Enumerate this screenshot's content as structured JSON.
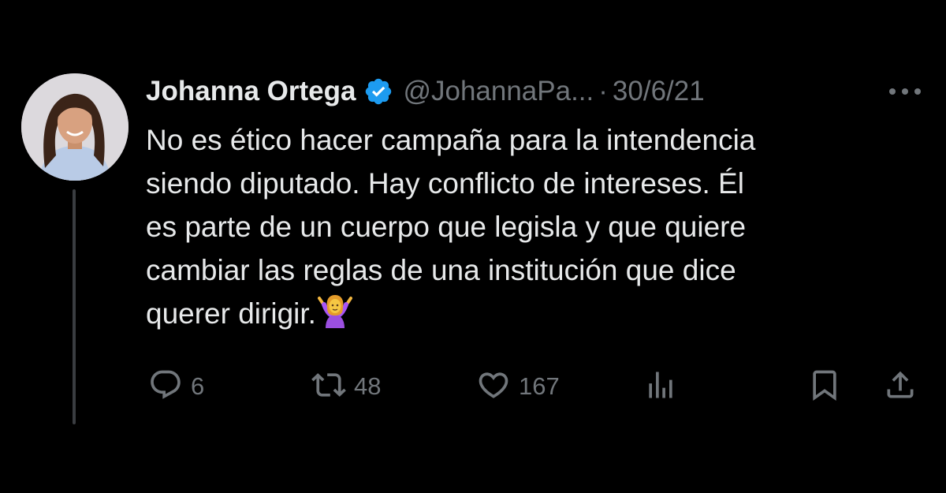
{
  "tweet": {
    "author": {
      "name": "Johanna Ortega",
      "handle": "@JohannaPa...",
      "verified": true
    },
    "separator": "·",
    "date": "30/6/21",
    "body_lines": [
      "No es ético hacer campaña para la intendencia",
      "siendo diputado. Hay conflicto de intereses. Él",
      "es parte de un cuerpo que legisla y que quiere",
      "cambiar las reglas de una institución que dice",
      "querer dirigir."
    ],
    "emoji": "woman-shrugging-emoji"
  },
  "actions": {
    "replies": "6",
    "retweets": "48",
    "likes": "167"
  },
  "icons": {
    "more": "more-dots-icon",
    "verified": "verified-badge-icon",
    "reply": "reply-icon",
    "retweet": "retweet-icon",
    "like": "heart-icon",
    "views": "views-icon",
    "bookmark": "bookmark-icon",
    "share": "share-icon"
  },
  "colors": {
    "background": "#000000",
    "text": "#e7e9ea",
    "secondary": "#71767b",
    "verified": "#1d9bf0",
    "thread_line": "#3a3d41"
  }
}
